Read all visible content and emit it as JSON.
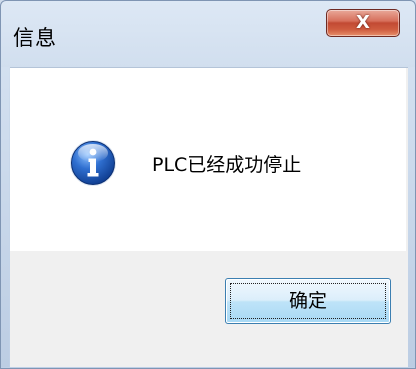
{
  "window": {
    "title": "信息",
    "close_label": "X"
  },
  "dialog": {
    "icon": "info-icon",
    "message": "PLC已经成功停止",
    "ok_label": "确定"
  },
  "colors": {
    "close_button": "#c24a33",
    "ok_button": "#bee3f8",
    "info_icon": "#1d55b5"
  }
}
